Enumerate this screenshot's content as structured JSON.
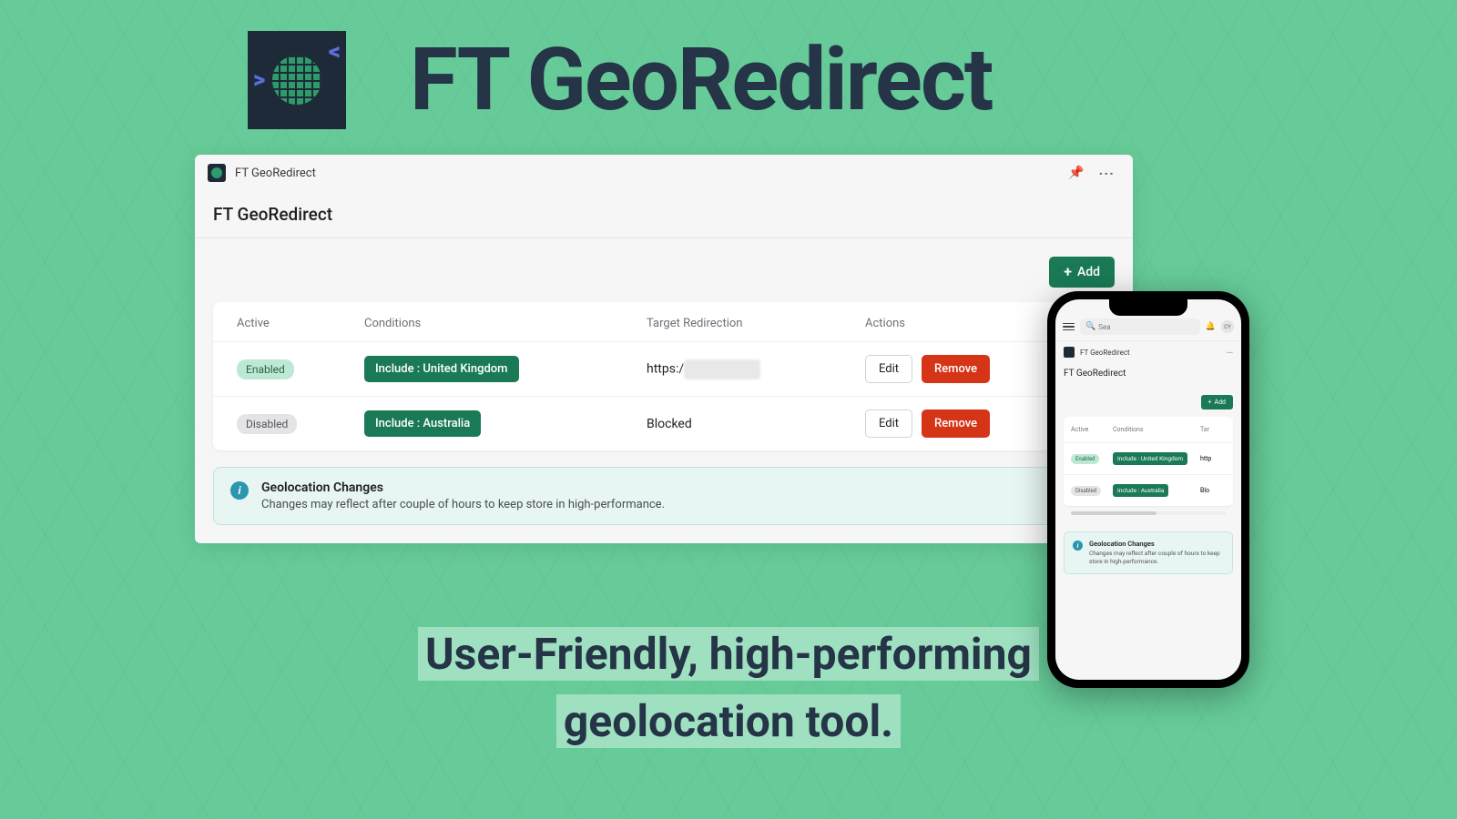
{
  "hero": {
    "title": "FT GeoRedirect"
  },
  "window": {
    "app_name": "FT GeoRedirect",
    "page_title": "FT GeoRedirect",
    "add_label": "Add",
    "headers": {
      "active": "Active",
      "conditions": "Conditions",
      "target": "Target Redirection",
      "actions": "Actions"
    },
    "rows": [
      {
        "active_label": "Enabled",
        "active_state": "enabled",
        "condition": "Include : United Kingdom",
        "target_prefix": "https:/",
        "target_hidden": true,
        "edit": "Edit",
        "remove": "Remove"
      },
      {
        "active_label": "Disabled",
        "active_state": "disabled",
        "condition": "Include : Australia",
        "target": "Blocked",
        "edit": "Edit",
        "remove": "Remove"
      }
    ],
    "info": {
      "title": "Geolocation Changes",
      "text": "Changes may reflect after couple of hours to keep store in high-performance."
    }
  },
  "tagline": {
    "line1": "User-Friendly, high-performing",
    "line2": "geolocation tool."
  },
  "mobile": {
    "search_placeholder": "Sea",
    "avatar": "CY",
    "app_name": "FT GeoRedirect",
    "page_title": "FT GeoRedirect",
    "add_label": "Add",
    "headers": {
      "active": "Active",
      "conditions": "Conditions",
      "target": "Tar"
    },
    "rows": [
      {
        "active_label": "Enabled",
        "active_state": "enabled",
        "condition": "Include : United Kingdom",
        "target": "http"
      },
      {
        "active_label": "Disabled",
        "active_state": "disabled",
        "condition": "Include : Australia",
        "target": "Blo"
      }
    ],
    "info": {
      "title": "Geolocation Changes",
      "text": "Changes may reflect after couple of hours to keep store in high-performance."
    }
  }
}
